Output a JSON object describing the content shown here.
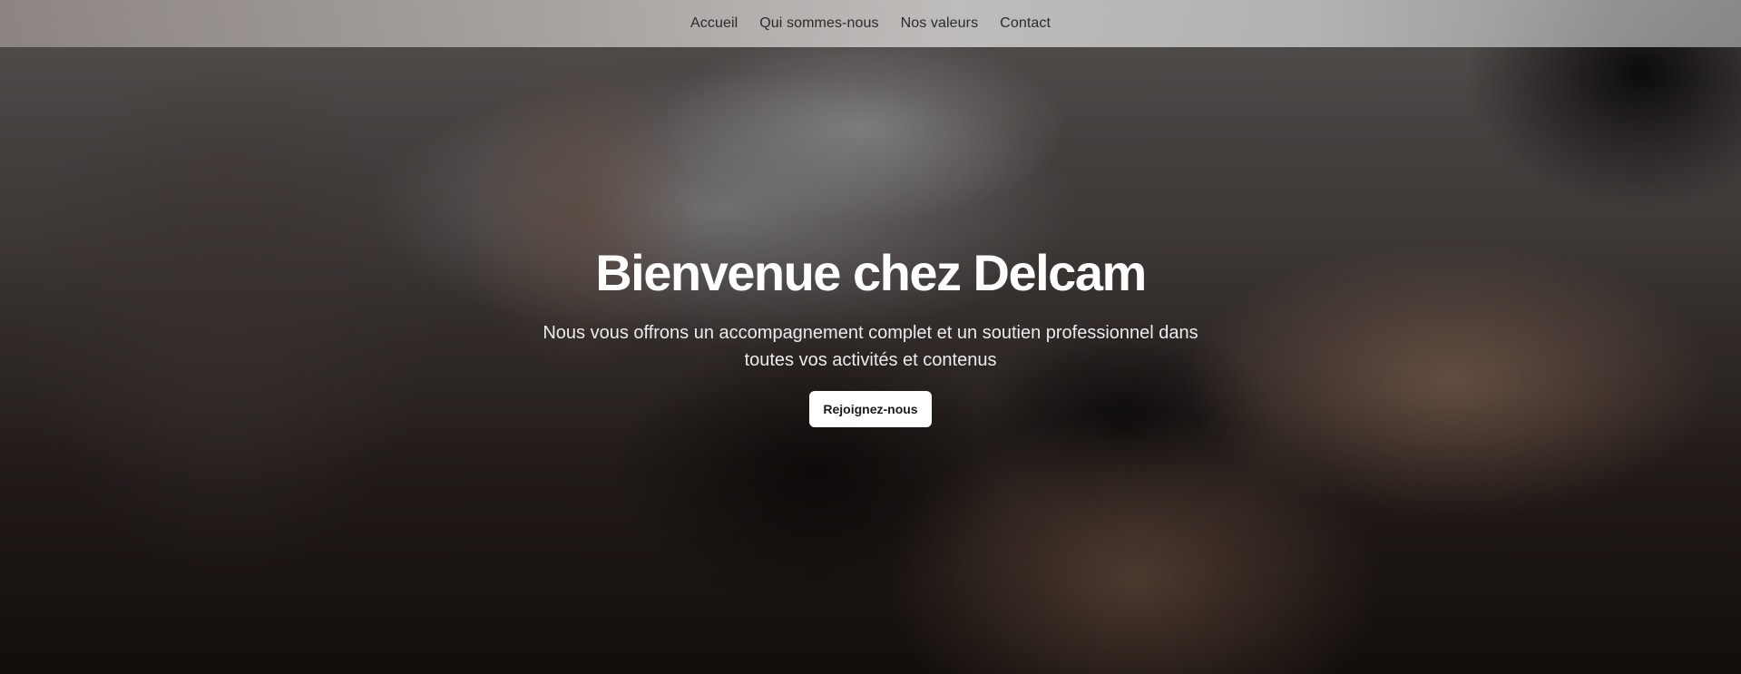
{
  "nav": {
    "items": [
      {
        "label": "Accueil"
      },
      {
        "label": "Qui sommes-nous"
      },
      {
        "label": "Nos valeurs"
      },
      {
        "label": "Contact"
      }
    ]
  },
  "hero": {
    "title": "Bienvenue chez Delcam",
    "subtitle": "Nous vous offrons un accompagnement complet et un soutien professionnel dans toutes vos activités et contenus",
    "cta_label": "Rejoignez-nous"
  }
}
